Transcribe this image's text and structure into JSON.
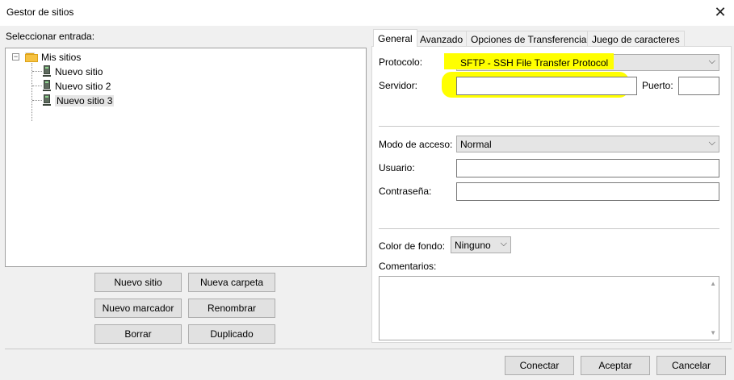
{
  "window": {
    "title": "Gestor de sitios",
    "close_glyph": "✕"
  },
  "left": {
    "label": "Seleccionar entrada:",
    "tree": {
      "root": {
        "label": "Mis sitios",
        "expander": "−",
        "icon": "folder-icon"
      },
      "items": [
        {
          "label": "Nuevo sitio",
          "icon": "server-icon"
        },
        {
          "label": "Nuevo sitio 2",
          "icon": "server-icon"
        },
        {
          "label": "Nuevo sitio 3",
          "icon": "server-icon",
          "selected": true
        }
      ]
    },
    "buttons": {
      "new_site": "Nuevo sitio",
      "new_folder": "Nueva carpeta",
      "new_bookmark": "Nuevo marcador",
      "rename": "Renombrar",
      "delete": "Borrar",
      "duplicate": "Duplicado"
    }
  },
  "tabs": [
    "General",
    "Avanzado",
    "Opciones de Transferencia",
    "Juego de caracteres"
  ],
  "active_tab": "General",
  "general": {
    "protocol_label": "Protocolo:",
    "protocol_value": "SFTP - SSH File Transfer Protocol",
    "server_label": "Servidor:",
    "server_value": "",
    "port_label": "Puerto:",
    "port_value": "",
    "access_mode_label": "Modo de acceso:",
    "access_mode_value": "Normal",
    "user_label": "Usuario:",
    "user_value": "",
    "password_label": "Contraseña:",
    "password_value": "",
    "bgcolor_label": "Color de fondo:",
    "bgcolor_value": "Ninguno",
    "comments_label": "Comentarios:",
    "comments_value": ""
  },
  "footer": {
    "connect": "Conectar",
    "accept": "Aceptar",
    "cancel": "Cancelar"
  },
  "colors": {
    "highlight": "#ffff00",
    "dialog_bg": "#f0f0f0",
    "button_bg": "#e1e1e1",
    "folder": "#f6c242"
  }
}
